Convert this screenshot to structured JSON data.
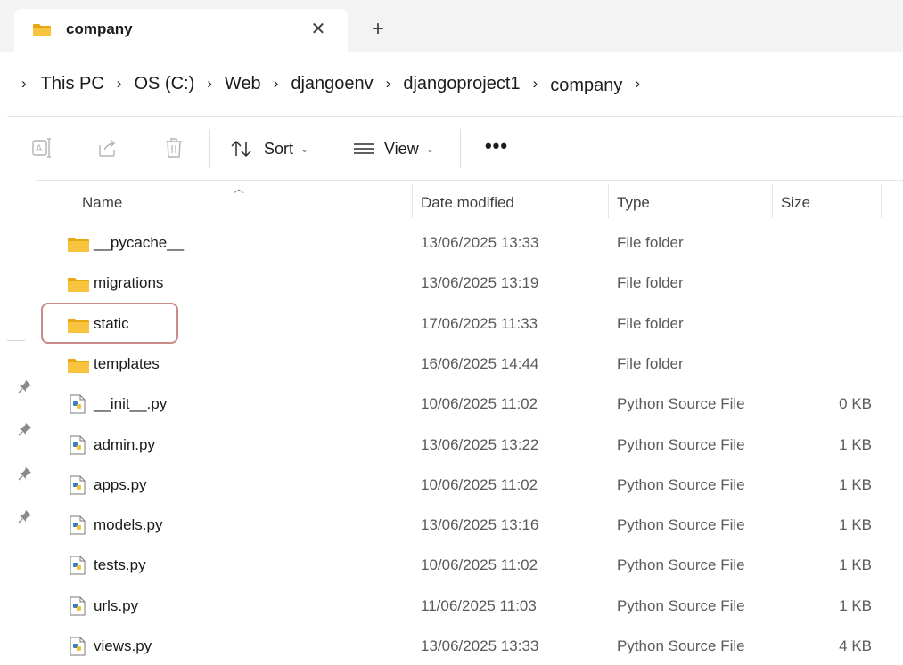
{
  "tab": {
    "title": "company",
    "icon": "folder-icon",
    "close_glyph": "✕",
    "new_tab_glyph": "+"
  },
  "breadcrumb": {
    "separator": "›",
    "items": [
      "This PC",
      "OS (C:)",
      "Web",
      "djangoenv",
      "djangoproject1",
      "company"
    ]
  },
  "toolbar": {
    "sort_label": "Sort",
    "view_label": "View",
    "more_label": "•••",
    "chevron": "⌄"
  },
  "columns": {
    "name": "Name",
    "date": "Date modified",
    "type": "Type",
    "size": "Size"
  },
  "files": [
    {
      "name": "__pycache__",
      "date": "13/06/2025 13:33",
      "type": "File folder",
      "size": "",
      "kind": "folder"
    },
    {
      "name": "migrations",
      "date": "13/06/2025 13:19",
      "type": "File folder",
      "size": "",
      "kind": "folder"
    },
    {
      "name": "static",
      "date": "17/06/2025 11:33",
      "type": "File folder",
      "size": "",
      "kind": "folder",
      "highlighted": true
    },
    {
      "name": "templates",
      "date": "16/06/2025 14:44",
      "type": "File folder",
      "size": "",
      "kind": "folder"
    },
    {
      "name": "__init__.py",
      "date": "10/06/2025 11:02",
      "type": "Python Source File",
      "size": "0 KB",
      "kind": "python"
    },
    {
      "name": "admin.py",
      "date": "13/06/2025 13:22",
      "type": "Python Source File",
      "size": "1 KB",
      "kind": "python"
    },
    {
      "name": "apps.py",
      "date": "10/06/2025 11:02",
      "type": "Python Source File",
      "size": "1 KB",
      "kind": "python"
    },
    {
      "name": "models.py",
      "date": "13/06/2025 13:16",
      "type": "Python Source File",
      "size": "1 KB",
      "kind": "python"
    },
    {
      "name": "tests.py",
      "date": "10/06/2025 11:02",
      "type": "Python Source File",
      "size": "1 KB",
      "kind": "python"
    },
    {
      "name": "urls.py",
      "date": "11/06/2025 11:03",
      "type": "Python Source File",
      "size": "1 KB",
      "kind": "python"
    },
    {
      "name": "views.py",
      "date": "13/06/2025 13:33",
      "type": "Python Source File",
      "size": "4 KB",
      "kind": "python"
    }
  ],
  "colors": {
    "folder": "#f8c33f",
    "folder_dark": "#e8a814",
    "highlight_border": "#c98a8a",
    "python_blue": "#3a7fc4"
  }
}
